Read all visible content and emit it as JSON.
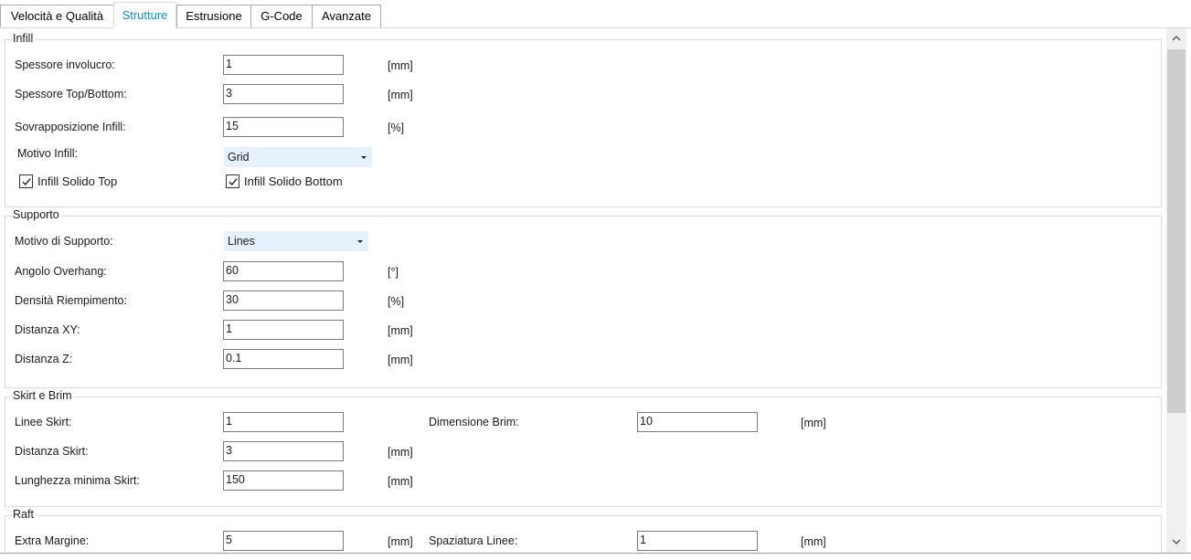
{
  "tabs": [
    "Velocità e Qualità",
    "Strutture",
    "Estrusione",
    "G-Code",
    "Avanzate"
  ],
  "infill": {
    "title": "Infill",
    "shell_label": "Spessore involucro:",
    "shell_value": "1",
    "shell_unit": "[mm]",
    "topbottom_label": "Spessore Top/Bottom:",
    "topbottom_value": "3",
    "topbottom_unit": "[mm]",
    "overlap_label": "Sovrapposizione Infill:",
    "overlap_value": "15",
    "overlap_unit": "[%]",
    "pattern_label": "Motivo Infill:",
    "pattern_value": "Grid",
    "solid_top_label": "Infill Solido Top",
    "solid_top_checked": true,
    "solid_bottom_label": "Infill Solido Bottom",
    "solid_bottom_checked": true
  },
  "support": {
    "title": "Supporto",
    "pattern_label": "Motivo di Supporto:",
    "pattern_value": "Lines",
    "overhang_label": "Angolo Overhang:",
    "overhang_value": "60",
    "overhang_unit": "[°]",
    "density_label": "Densità Riempimento:",
    "density_value": "30",
    "density_unit": "[%]",
    "xy_label": "Distanza XY:",
    "xy_value": "1",
    "xy_unit": "[mm]",
    "z_label": "Distanza Z:",
    "z_value": "0.1",
    "z_unit": "[mm]"
  },
  "skirt": {
    "title": "Skirt e Brim",
    "lines_label": "Linee Skirt:",
    "lines_value": "1",
    "brim_label": "Dimensione Brim:",
    "brim_value": "10",
    "brim_unit": "[mm]",
    "distance_label": "Distanza Skirt:",
    "distance_value": "3",
    "distance_unit": "[mm]",
    "minlen_label": "Lunghezza minima Skirt:",
    "minlen_value": "150",
    "minlen_unit": "[mm]"
  },
  "raft": {
    "title": "Raft",
    "margin_label": "Extra Margine:",
    "margin_value": "5",
    "margin_unit": "[mm]",
    "spacing_label": "Spaziatura Linee:",
    "spacing_value": "1",
    "spacing_unit": "[mm]"
  },
  "colors": {
    "active_tab": "#1a8ac4",
    "combo_bg": "#e5f1fb",
    "scroll_thumb": "#cdcdcd"
  }
}
